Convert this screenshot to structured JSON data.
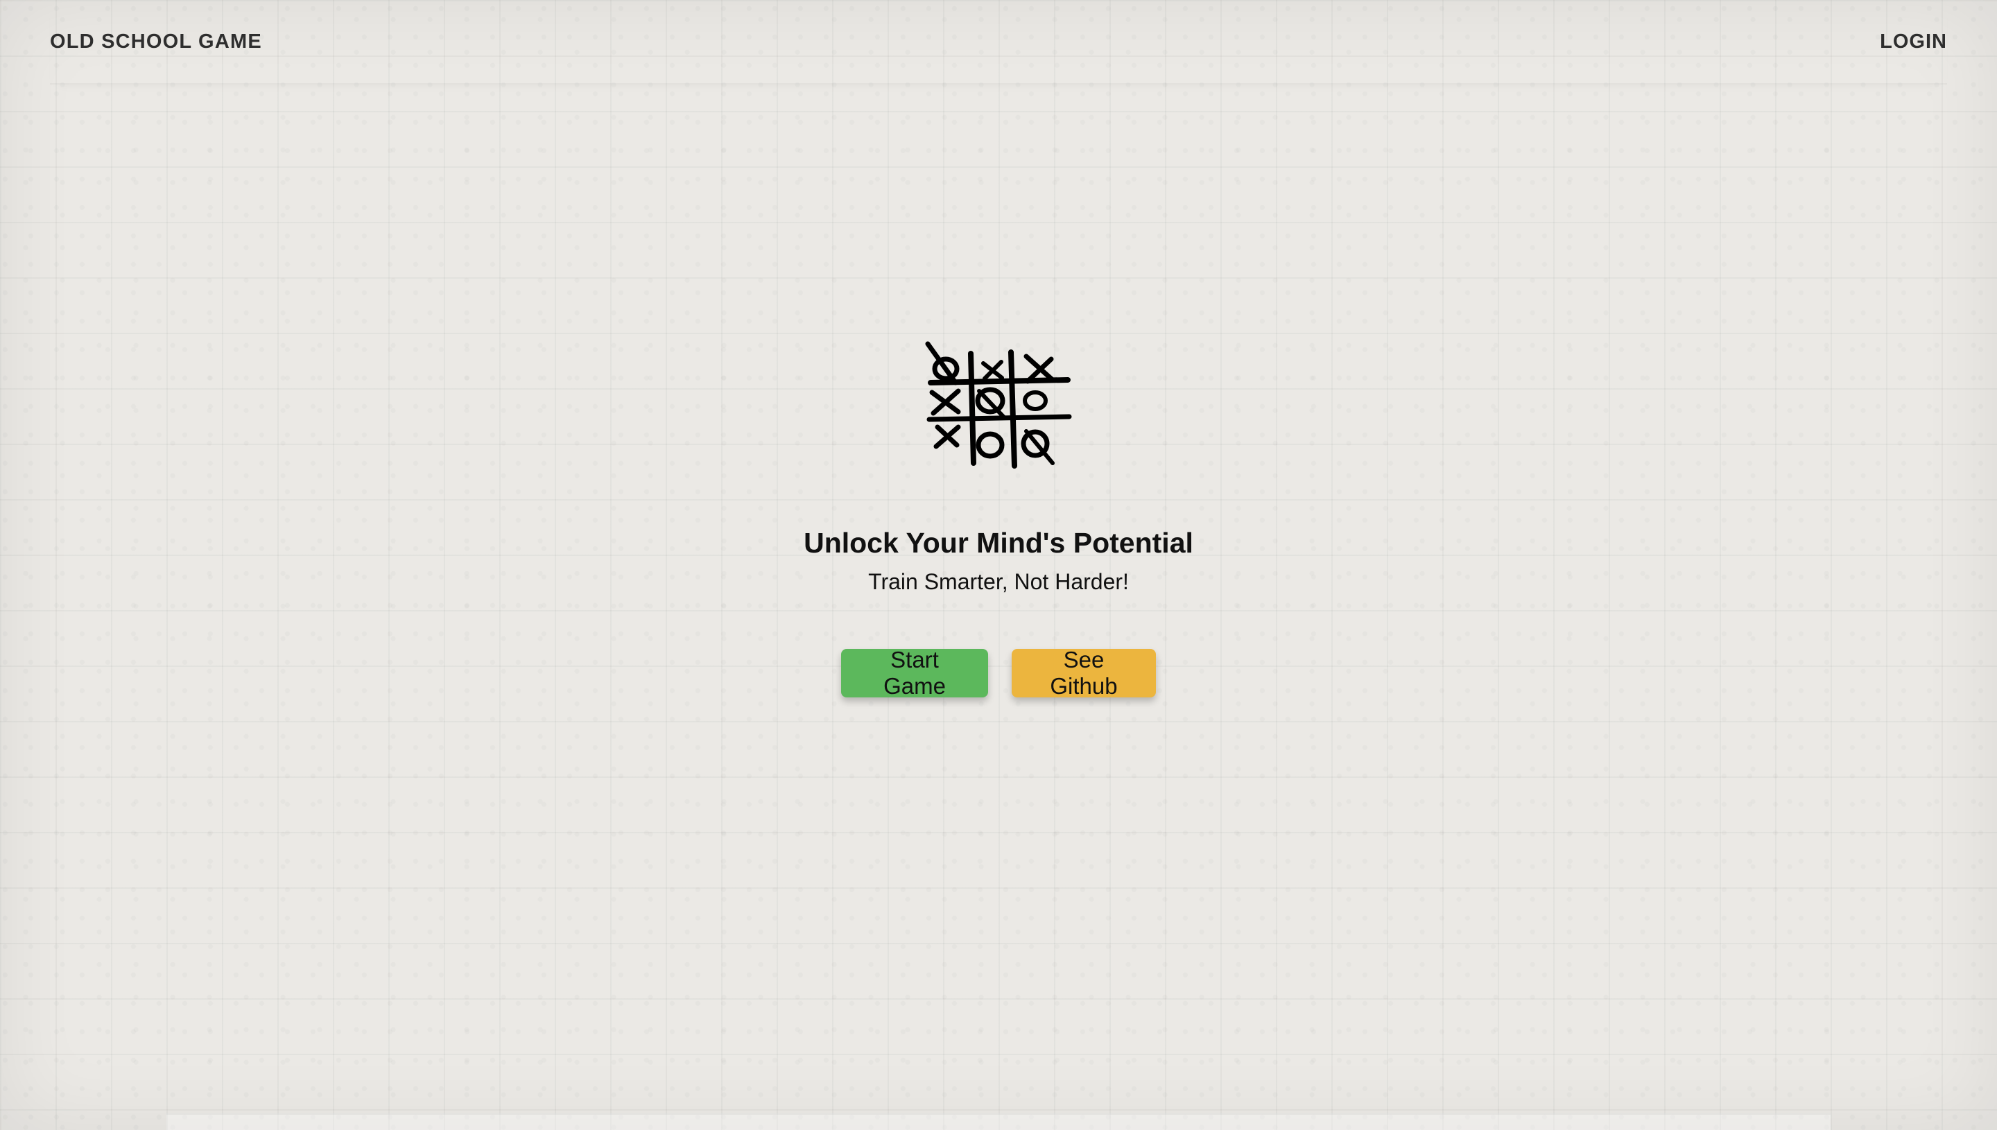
{
  "header": {
    "brand": "OLD SCHOOL GAME",
    "login_label": "LOGIN"
  },
  "hero": {
    "logo_icon": "tic-tac-toe-sketch-icon",
    "title": "Unlock Your Mind's Potential",
    "subtitle": "Train Smarter, Not Harder!"
  },
  "actions": {
    "start_label": "Start Game",
    "github_label": "See Github"
  },
  "colors": {
    "start_button": "#5cb85c",
    "github_button": "#ecb53e",
    "background": "#ebe9e5"
  }
}
